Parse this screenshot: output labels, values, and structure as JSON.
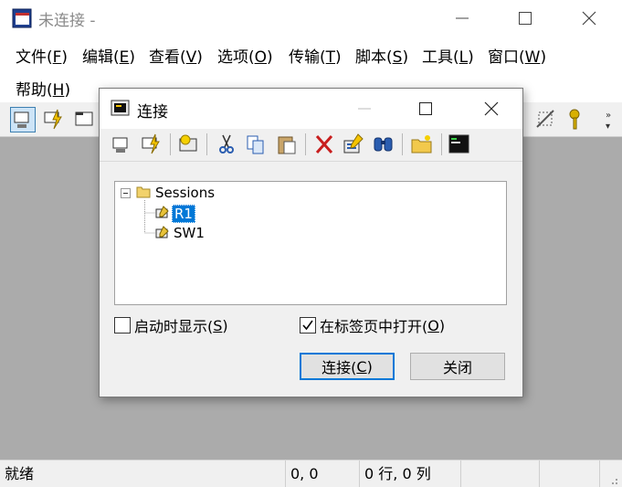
{
  "window": {
    "title": "未连接 -",
    "minimize_glyph": "—",
    "maximize_glyph": "☐",
    "close_glyph": "✕"
  },
  "menu": [
    {
      "label": "文件(",
      "key": "F",
      "end": ")"
    },
    {
      "label": "编辑(",
      "key": "E",
      "end": ")"
    },
    {
      "label": "查看(",
      "key": "V",
      "end": ")"
    },
    {
      "label": "选项(",
      "key": "O",
      "end": ")"
    },
    {
      "label": "传输(",
      "key": "T",
      "end": ")"
    },
    {
      "label": "脚本(",
      "key": "S",
      "end": ")"
    },
    {
      "label": "工具(",
      "key": "L",
      "end": ")"
    },
    {
      "label": "窗口(",
      "key": "W",
      "end": ")"
    },
    {
      "label": "帮助(",
      "key": "H",
      "end": ")"
    }
  ],
  "toolbar_icons": [
    "connect-icon",
    "quick-connect-icon",
    "connect-in-tab-icon",
    "disconnect-icon",
    "key-icon",
    "more-icon"
  ],
  "dialog": {
    "title": "连接",
    "toolbar_icons": [
      "connect-icon",
      "quick-connect-icon",
      "new-session-icon",
      "cut-icon",
      "copy-icon",
      "paste-icon",
      "delete-icon",
      "properties-icon",
      "find-icon",
      "new-folder-icon",
      "terminal-icon"
    ],
    "tree": {
      "root": "Sessions",
      "items": [
        "R1",
        "SW1"
      ],
      "selected": "R1"
    },
    "checkbox_startup": {
      "label": "启动时显示(",
      "key": "S",
      "end": ")",
      "checked": false
    },
    "checkbox_tab": {
      "label": "在标签页中打开(",
      "key": "O",
      "end": ")",
      "checked": true
    },
    "connect_button": {
      "label": "连接(",
      "key": "C",
      "end": ")"
    },
    "close_button": "关闭"
  },
  "status": {
    "ready": "就绪",
    "position": "0, 0",
    "rows_cols": "0 行, 0 列"
  },
  "colors": {
    "accent": "#0078d7",
    "workspace": "#ababab"
  }
}
